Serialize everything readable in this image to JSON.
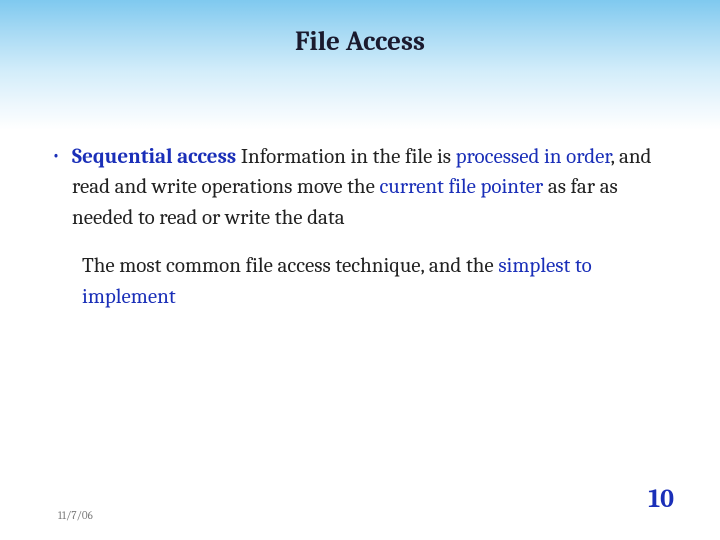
{
  "title": "File Access",
  "bullet": {
    "term": "Sequential access",
    "text_before": "  Information in the file is ",
    "highlight1": "processed in order",
    "text_mid1": ", and read and write operations move the ",
    "highlight2": "current file pointer",
    "text_after": " as far as needed to read or write the data"
  },
  "para2": {
    "text_before": "The most common file access technique, and the ",
    "highlight": "simplest to implement"
  },
  "footer": {
    "date": "11/7/06",
    "page": "10"
  }
}
